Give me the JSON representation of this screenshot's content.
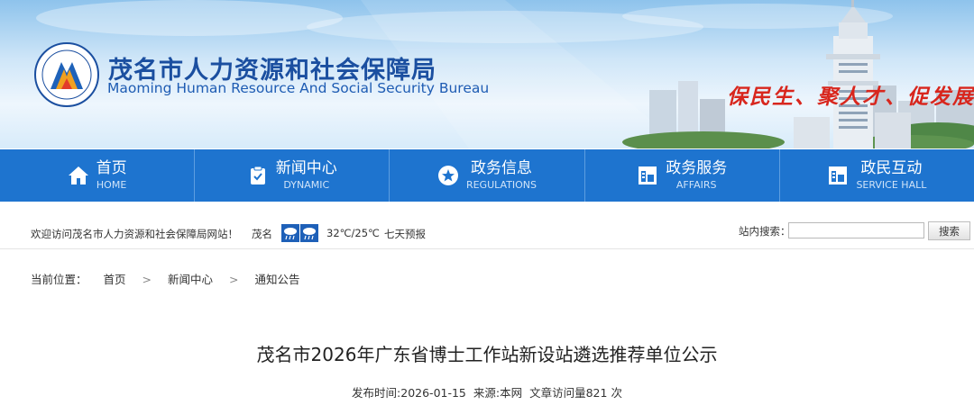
{
  "header": {
    "site_name": "茂名市人力资源和社会保障局",
    "site_name_en": "Maoming Human Resource And Social Security Bureau",
    "slogan": "保民生、聚人才、促发展"
  },
  "nav": {
    "items": [
      {
        "label": "首页",
        "sub": "HOME",
        "icon": "home-icon"
      },
      {
        "label": "新闻中心",
        "sub": "DYNAMIC",
        "icon": "clipboard-icon"
      },
      {
        "label": "政务信息",
        "sub": "REGULATIONS",
        "icon": "star-icon"
      },
      {
        "label": "政务服务",
        "sub": "AFFAIRS",
        "icon": "building-icon"
      },
      {
        "label": "政民互动",
        "sub": "SERVICE HALL",
        "icon": "building-icon"
      }
    ]
  },
  "infobar": {
    "welcome": "欢迎访问茂名市人力资源和社会保障局网站！",
    "city": "茂名",
    "weather_icons": [
      "rain-icon",
      "rain-icon"
    ],
    "temperature": "32℃/25℃",
    "forecast_link": "七天预报",
    "search_label": "站内搜索：",
    "search_value": "",
    "search_button": "搜索"
  },
  "breadcrumb": {
    "label": "当前位置：",
    "items": [
      "首页",
      "新闻中心",
      "通知公告"
    ],
    "separator": ">"
  },
  "article": {
    "title": "茂名市2026年广东省博士工作站新设站遴选推荐单位公示",
    "published": "发布时间:2026-01-15",
    "source": "来源:本网",
    "views": "文章访问量821 次"
  },
  "colors": {
    "nav_bg": "#1e74cf",
    "title_blue": "#1b4fa0",
    "slogan_red": "#d8261d"
  }
}
